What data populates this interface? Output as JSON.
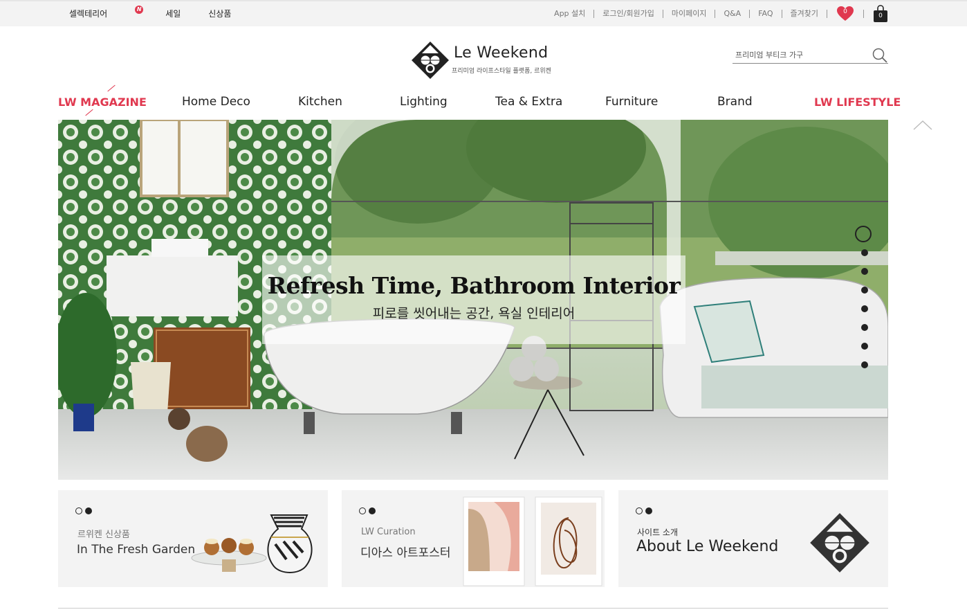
{
  "topbar": {
    "left_links": [
      "셀렉테리어",
      "세일",
      "신상품"
    ],
    "new_badge": "N",
    "right_links": [
      "App 설치",
      "로그인/회원가입",
      "마이페이지",
      "Q&A",
      "FAQ",
      "즐겨찾기"
    ],
    "wishlist_count": "0",
    "cart_count": "0"
  },
  "header": {
    "brand_name": "Le Weekend",
    "tagline": "프리미엄 라이프스타일 플랫폼, 르위켄",
    "search_placeholder": "프리미엄 부티크 가구"
  },
  "nav": {
    "items": [
      "LW MAGAZINE",
      "Home Deco",
      "Kitchen",
      "Lighting",
      "Tea & Extra",
      "Furniture",
      "Brand",
      "LW LIFESTYLE"
    ]
  },
  "hero": {
    "title": "Refresh Time, Bathroom Interior",
    "subtitle": "피로를 씻어내는 공간, 욕실 인테리어",
    "slide_count": 8,
    "active_slide": 1
  },
  "cards": [
    {
      "sub": "르위켄 신상품",
      "main": "In The Fresh Garden"
    },
    {
      "sub": "LW Curation",
      "main": "디아스 아트포스터"
    },
    {
      "sub": "사이트 소개",
      "main": "About Le Weekend"
    }
  ],
  "colors": {
    "accent": "#e0384f",
    "topbar_bg": "#f3f3f3",
    "card_bg": "#f3f3f3"
  }
}
